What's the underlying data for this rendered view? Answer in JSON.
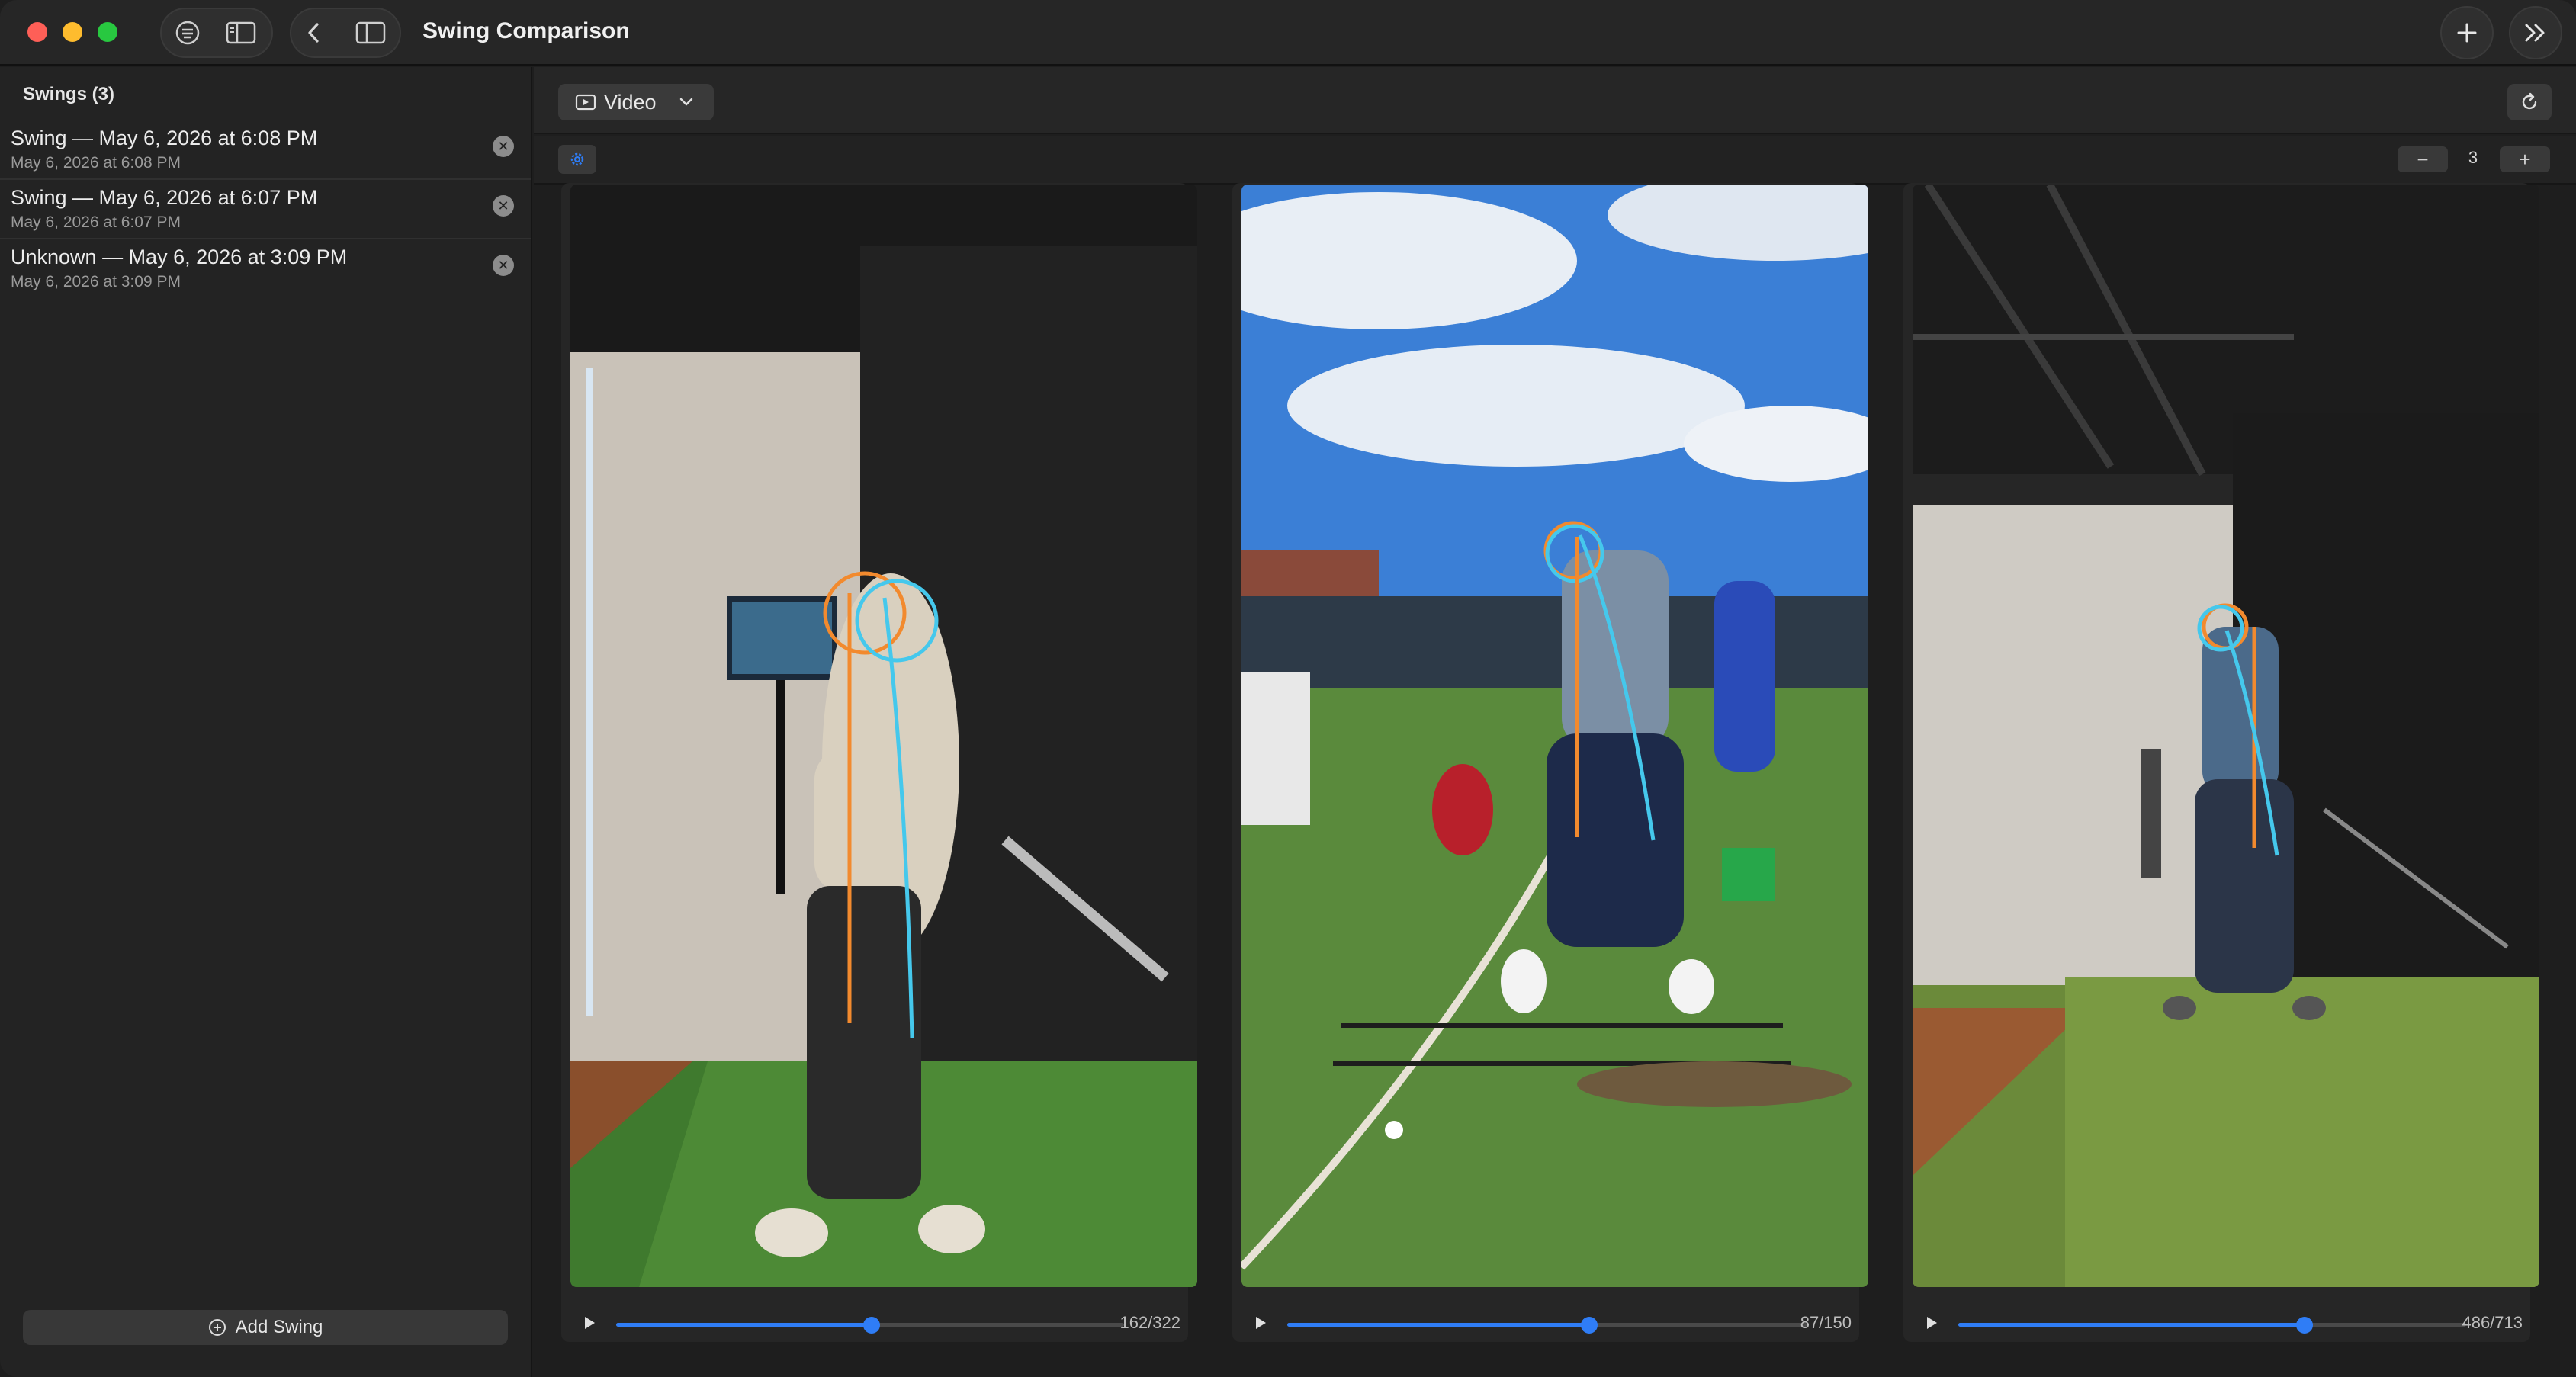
{
  "window": {
    "title": "Swing Comparison"
  },
  "sidebar": {
    "header": "Swings (3)",
    "items": [
      {
        "title": "Swing — May 6, 2026 at 6:08 PM",
        "subtitle": "May 6, 2026 at 6:08 PM"
      },
      {
        "title": "Swing — May 6, 2026 at 6:07 PM",
        "subtitle": "May 6, 2026 at 6:07 PM"
      },
      {
        "title": "Unknown — May 6, 2026 at 3:09 PM",
        "subtitle": "May 6, 2026 at 3:09 PM"
      }
    ],
    "add_label": "Add Swing"
  },
  "toolbar": {
    "mode_label": "Video",
    "columns_value": "3",
    "minus_label": "−",
    "plus_label": "+"
  },
  "videos": [
    {
      "counter": "162/322",
      "progress": 0.503
    },
    {
      "counter": "87/150",
      "progress": 0.58
    },
    {
      "counter": "486/713",
      "progress": 0.682
    }
  ],
  "colors": {
    "accent": "#2f7df6",
    "overlay_orange": "#f28a2e",
    "overlay_cyan": "#45c8ec"
  },
  "icons": [
    "close-window-icon",
    "minimize-icon",
    "zoom-icon",
    "list-icon",
    "sidebar-icon",
    "back-icon",
    "inspector-icon",
    "plus-icon",
    "chevron-double-right-icon",
    "video-icon",
    "chevron-down-icon",
    "refresh-icon",
    "gear-icon",
    "play-icon",
    "plus-circle-icon",
    "remove-icon"
  ]
}
